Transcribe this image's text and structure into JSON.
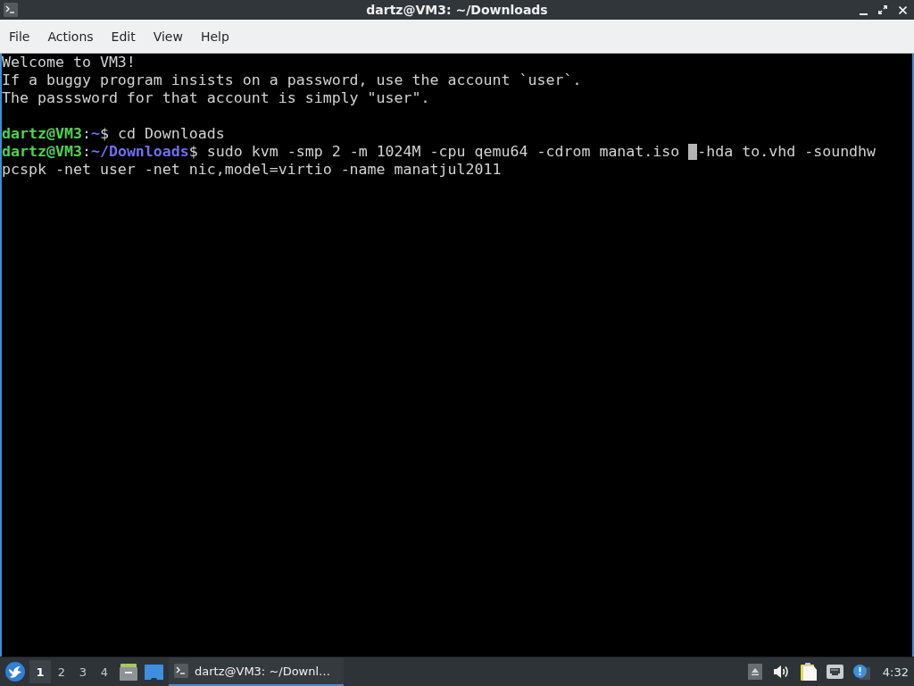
{
  "window": {
    "title": "dartz@VM3: ~/Downloads"
  },
  "menu": [
    {
      "label": "File"
    },
    {
      "label": "Actions"
    },
    {
      "label": "Edit"
    },
    {
      "label": "View"
    },
    {
      "label": "Help"
    }
  ],
  "terminal": {
    "lines": [
      {
        "kind": "output",
        "text": "Welcome to VM3!"
      },
      {
        "kind": "output",
        "text": "If a buggy program insists on a password, use the account `user`."
      },
      {
        "kind": "output",
        "text": "The passsword for that account is simply \"user\"."
      },
      {
        "kind": "blank"
      },
      {
        "kind": "prompt",
        "user_host": "dartz@VM3",
        "separator": ":",
        "path": "~",
        "symbol": "$",
        "command": "cd Downloads",
        "cursor": false
      },
      {
        "kind": "prompt",
        "user_host": "dartz@VM3",
        "separator": ":",
        "path": "~/Downloads",
        "symbol": "$",
        "command": "sudo kvm -smp 2 -m 1024M -cpu qemu64 -cdrom manat.iso",
        "cursor": true,
        "after_cursor": "-hda to.vhd -soundhw"
      },
      {
        "kind": "output",
        "text": "pcspk -net user -net nic,model=virtio -name manatjul2011"
      }
    ]
  },
  "taskbar": {
    "workspaces": [
      {
        "label": "1",
        "selected": true
      },
      {
        "label": "2",
        "selected": false
      },
      {
        "label": "3",
        "selected": false
      },
      {
        "label": "4",
        "selected": false
      }
    ],
    "tasks": [
      {
        "label": "dartz@VM3: ~/Downl…",
        "active": true
      }
    ],
    "clock": "4:32"
  }
}
